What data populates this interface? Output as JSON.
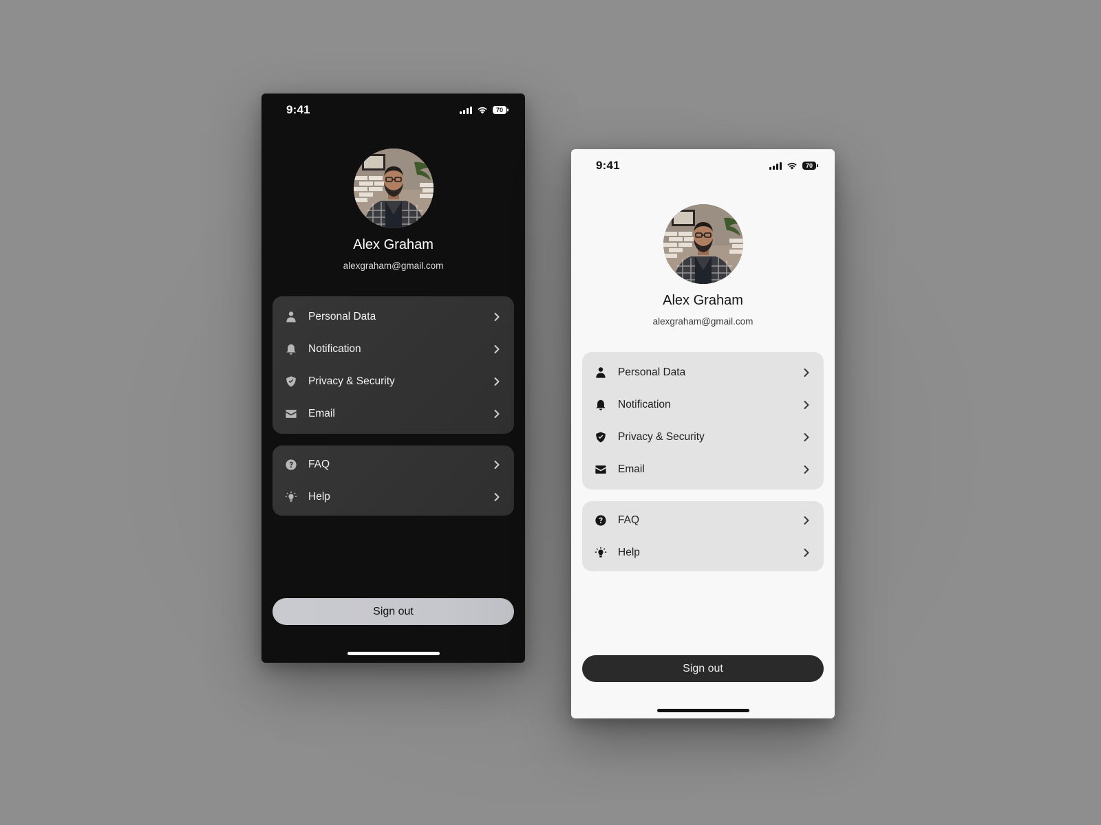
{
  "screens": [
    {
      "theme": "dark",
      "status_bar": {
        "time": "9:41",
        "battery_level": "70"
      },
      "profile": {
        "name": "Alex Graham",
        "email": "alexgraham@gmail.com",
        "avatar_alt": "profile photo"
      },
      "account_menu": [
        {
          "label": "Personal Data",
          "icon": "person-icon"
        },
        {
          "label": "Notification",
          "icon": "bell-icon"
        },
        {
          "label": "Privacy & Security",
          "icon": "shield-check-icon"
        },
        {
          "label": "Email",
          "icon": "envelope-icon"
        }
      ],
      "support_menu": [
        {
          "label": "FAQ",
          "icon": "question-circle-icon"
        },
        {
          "label": "Help",
          "icon": "lightbulb-icon"
        }
      ],
      "sign_out_label": "Sign out"
    },
    {
      "theme": "light",
      "status_bar": {
        "time": "9:41",
        "battery_level": "70"
      },
      "profile": {
        "name": "Alex Graham",
        "email": "alexgraham@gmail.com",
        "avatar_alt": "profile photo"
      },
      "account_menu": [
        {
          "label": "Personal Data",
          "icon": "person-icon"
        },
        {
          "label": "Notification",
          "icon": "bell-icon"
        },
        {
          "label": "Privacy & Security",
          "icon": "shield-check-icon"
        },
        {
          "label": "Email",
          "icon": "envelope-icon"
        }
      ],
      "support_menu": [
        {
          "label": "FAQ",
          "icon": "question-circle-icon"
        },
        {
          "label": "Help",
          "icon": "lightbulb-icon"
        }
      ],
      "sign_out_label": "Sign out"
    }
  ],
  "colors": {
    "page_background": "#8e8e8e",
    "dark_screen": "#0f0f0f",
    "dark_card": "#343434",
    "dark_button": "#c8c9cf",
    "light_screen": "#f8f8f8",
    "light_card": "#e3e3e3",
    "light_button": "#2a2a2a"
  }
}
